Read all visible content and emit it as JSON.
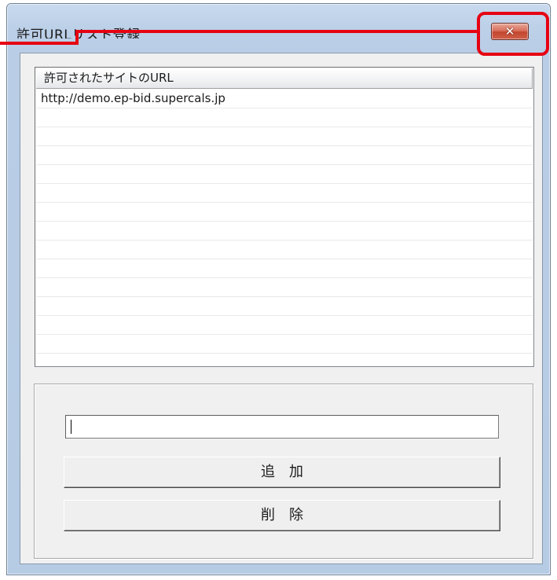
{
  "window": {
    "title": "許可URLリスト登録",
    "close_symbol": "✕"
  },
  "list": {
    "column_header": "許可されたサイトのURL",
    "rows": [
      "http://demo.ep-bid.supercals.jp"
    ]
  },
  "form": {
    "url_value": "",
    "add_label": "追加",
    "delete_label": "削除"
  },
  "colors": {
    "callout": "#e60012",
    "close_button": "#c2462f",
    "window_frame": "#bcd0e8",
    "client_bg": "#f0f0f0"
  },
  "icons": {
    "close": "close-icon"
  }
}
